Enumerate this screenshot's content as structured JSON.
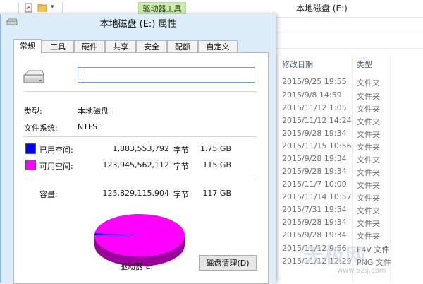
{
  "explorer": {
    "title": "本地磁盘 (E:)",
    "tool_tab": "驱动器工具",
    "columns": {
      "date": "修改日期",
      "type": "类型"
    },
    "rows": [
      {
        "date": "2015/9/25 19:55",
        "type": "文件夹"
      },
      {
        "date": "2015/9/8 14:59",
        "type": "文件夹"
      },
      {
        "date": "2015/11/12 1:05",
        "type": "文件夹"
      },
      {
        "date": "2015/11/12 14:24",
        "type": "文件夹"
      },
      {
        "date": "2015/9/28 19:34",
        "type": "文件夹"
      },
      {
        "date": "2015/11/15 10:56",
        "type": "文件夹"
      },
      {
        "date": "2015/9/28 19:34",
        "type": "文件夹"
      },
      {
        "date": "2015/9/28 19:34",
        "type": "文件夹"
      },
      {
        "date": "2015/11/7 10:00",
        "type": "文件夹"
      },
      {
        "date": "2015/11/14 10:57",
        "type": "文件夹"
      },
      {
        "date": "2015/7/31 19:54",
        "type": "文件夹"
      },
      {
        "date": "2015/9/28 19:34",
        "type": "文件夹"
      },
      {
        "date": "2015/9/28 19:34",
        "type": "文件夹"
      },
      {
        "date": "2015/11/12 9:56",
        "type": "F4V 文件"
      },
      {
        "date": "2015/11/12 12:29",
        "type": "PNG 文件"
      }
    ],
    "watermark": "天极网",
    "watermark_url": "www.52ij.com"
  },
  "dialog": {
    "title": "本地磁盘 (E:) 属性",
    "tabs": [
      "常规",
      "工具",
      "硬件",
      "共享",
      "安全",
      "配额",
      "自定义"
    ],
    "active_tab": 0,
    "drive_name_value": "",
    "type_label": "类型:",
    "type_value": "本地磁盘",
    "fs_label": "文件系统:",
    "fs_value": "NTFS",
    "used": {
      "label": "已用空间:",
      "bytes": "1,883,553,792",
      "unit": "字节",
      "gb": "1.75 GB",
      "color": "#0000ff"
    },
    "free": {
      "label": "可用空间:",
      "bytes": "123,945,562,112",
      "unit": "字节",
      "gb": "115 GB",
      "color": "#ff00ff"
    },
    "capacity": {
      "label": "容量:",
      "bytes": "125,829,115,904",
      "unit": "字节",
      "gb": "117 GB"
    },
    "drive_label": "驱动器 E:",
    "cleanup_button": "磁盘清理(D)"
  },
  "chart_data": {
    "type": "pie",
    "categories": [
      "已用空间",
      "可用空间"
    ],
    "values": [
      1883553792,
      123945562112
    ],
    "colors": [
      "#0000ff",
      "#ff00ff"
    ]
  }
}
